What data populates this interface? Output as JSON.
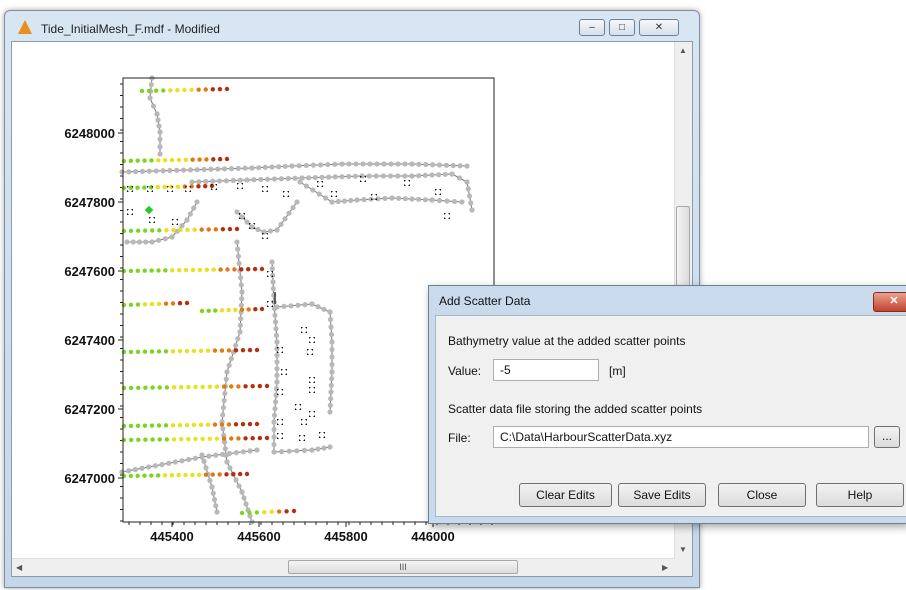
{
  "window": {
    "title": "Tide_InitialMesh_F.mdf - Modified",
    "minimize_glyph": "–",
    "maximize_glyph": "□",
    "close_glyph": "✕",
    "hscroll_grip": "III",
    "scroll_up": "▲",
    "scroll_down": "▼",
    "scroll_left": "◀",
    "scroll_right": "▶"
  },
  "plot": {
    "y_ticks": [
      "6248000",
      "6247800",
      "6247600",
      "6247400",
      "6247200",
      "6247000"
    ],
    "x_ticks": [
      "445400",
      "445600",
      "445800",
      "446000"
    ],
    "colors": {
      "node": "#b8b8b8",
      "line": "#707070",
      "depth_green": "#7ed321",
      "depth_yellow": "#e8e020",
      "depth_orange": "#e07a10",
      "depth_red": "#b03010",
      "selected": "#22cc22"
    }
  },
  "dialog": {
    "title": "Add Scatter Data",
    "close_glyph": "✕",
    "value_description": "Bathymetry value at the added scatter points",
    "value_label": "Value:",
    "value": "-5",
    "value_unit": "[m]",
    "file_description": "Scatter data file storing the added scatter points",
    "file_label": "File:",
    "file_path": "C:\\Data\\HarbourScatterData.xyz",
    "browse_label": "...",
    "buttons": {
      "clear": "Clear Edits",
      "save": "Save Edits",
      "close": "Close",
      "help": "Help"
    }
  }
}
